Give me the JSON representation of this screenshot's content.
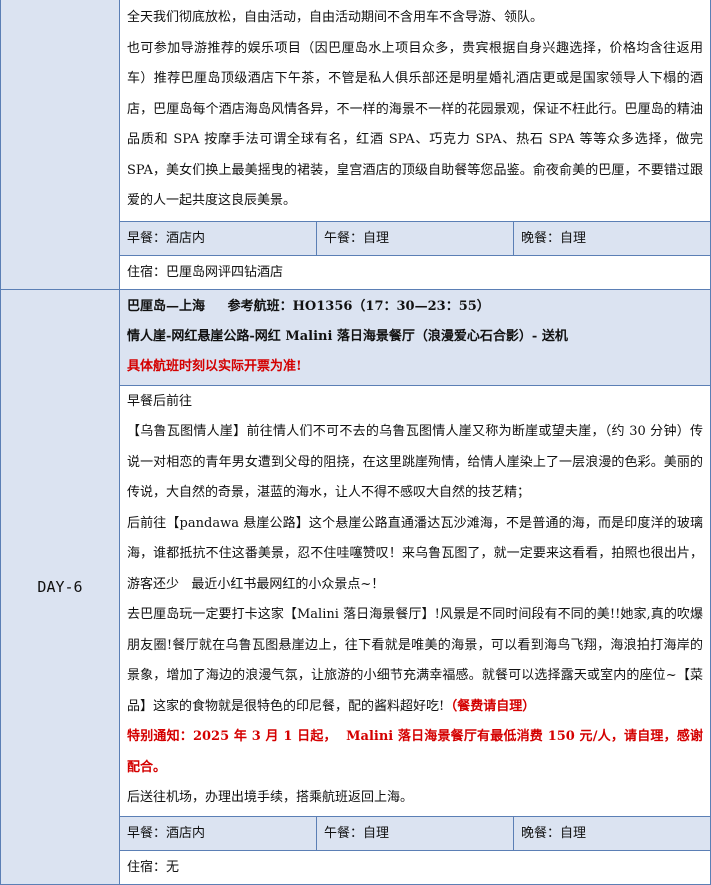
{
  "day5": {
    "paragraphs": [
      "全天我们彻底放松，自由活动，自由活动期间不含用车不含导游、领队。",
      "也可参加导游推荐的娱乐项目（因巴厘岛水上项目众多，贵宾根据自身兴趣选择，价格均含往返用车）推荐巴厘岛顶级酒店下午茶，不管是私人俱乐部还是明星婚礼酒店更或是国家领导人下榻的酒店，巴厘岛每个酒店海岛风情各异，不一样的海景不一样的花园景观，保证不枉此行。巴厘岛的精油品质和 SPA 按摩手法可谓全球有名，红酒 SPA、巧克力 SPA、热石 SPA 等等众多选择，做完 SPA，美女们换上最美摇曳的裙装，皇宫酒店的顶级自助餐等您品鉴。俞夜俞美的巴厘，不要错过跟爱的人一起共度这良辰美景。"
    ],
    "meals": {
      "breakfast": "早餐：酒店内",
      "lunch": "午餐：自理",
      "dinner": "晚餐：自理"
    },
    "lodging": "住宿：巴厘岛网评四钻酒店"
  },
  "day6": {
    "label": "DAY-6",
    "route": "巴厘岛—上海     参考航班：HO1356（17：30—23：55）",
    "highlights": "情人崖-网红悬崖公路-网红 Malini 落日海景餐厅（浪漫爱心石合影）- 送机",
    "flight_note": "具体航班时刻以实际开票为准!",
    "p1": "早餐后前往",
    "p2": "【乌鲁瓦图情人崖】前往情人们不可不去的乌鲁瓦图情人崖又称为断崖或望夫崖，（约 30 分钟）传说一对相恋的青年男女遭到父母的阻挠，在这里跳崖殉情，给情人崖染上了一层浪漫的色彩。美丽的传说，大自然的奇景，湛蓝的海水，让人不得不感叹大自然的技艺精；",
    "p3": "后前往【pandawa 悬崖公路】这个悬崖公路直通潘达瓦沙滩海，不是普通的海，而是印度洋的玻璃海，谁都抵抗不住这番美景，忍不住哇噻赞叹！来乌鲁瓦图了，就一定要来这看看，拍照也很出片，游客还少   最近小红书最网红的小众景点~！",
    "p4": "去巴厘岛玩一定要打卡这家【Malini 落日海景餐厅】!风景是不同时间段有不同的美!!她家,真的吹爆朋友圈!餐厅就在乌鲁瓦图悬崖边上，往下看就是唯美的海景，可以看到海鸟飞翔，海浪拍打海岸的景象，增加了海边的浪漫气氛，让旅游的小细节充满幸福感。就餐可以选择露天或室内的座位~【菜品】这家的食物就是很特色的印尼餐，配的酱料超好吃!",
    "p4_red": "（餐费请自理）",
    "notice": "特别通知：2025 年 3 月 1 日起，  Malini 落日海景餐厅有最低消费 150 元/人，请自理，感谢配合。",
    "p5": "后送往机场，办理出境手续，搭乘航班返回上海。",
    "meals": {
      "breakfast": "早餐：酒店内",
      "lunch": "午餐：自理",
      "dinner": "晚餐：自理"
    },
    "lodging": "住宿：无"
  }
}
